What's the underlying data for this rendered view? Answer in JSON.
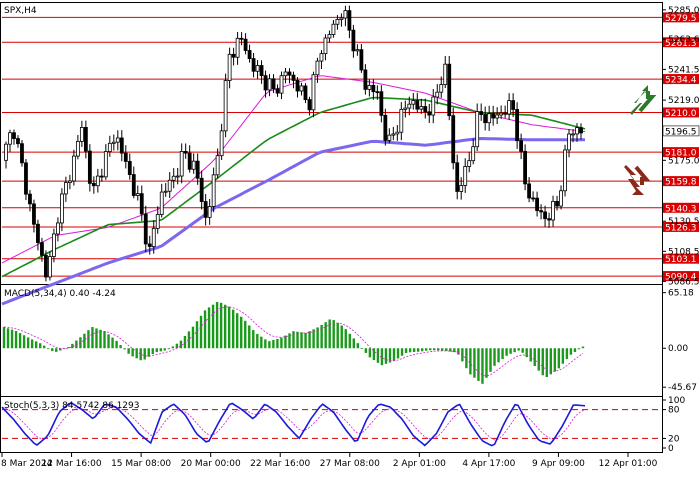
{
  "chart_data": [
    {
      "type": "candlestick",
      "title": "SPX,H4",
      "ylim": [
        5084.6,
        5290
      ],
      "yticks": [
        "5285.0",
        "5263.6",
        "5241.5",
        "5219.0",
        "5175.0",
        "5130.5",
        "5108.5",
        "5086.5"
      ],
      "levels": [
        {
          "value": 5279.5,
          "label": "5279.5"
        },
        {
          "value": 5261.3,
          "label": "5261.3"
        },
        {
          "value": 5234.4,
          "label": "5234.4"
        },
        {
          "value": 5210.0,
          "label": "5210.0"
        },
        {
          "value": 5181.0,
          "label": "5181.0"
        },
        {
          "value": 5159.8,
          "label": "5159.8"
        },
        {
          "value": 5140.3,
          "label": "5140.3"
        },
        {
          "value": 5126.3,
          "label": "5126.3"
        },
        {
          "value": 5103.1,
          "label": "5103.1"
        },
        {
          "value": 5090.4,
          "label": "5090.4"
        }
      ],
      "current_price": {
        "value": 5196.5,
        "label": "5196.5"
      },
      "moving_averages": [
        {
          "color": "#d81bd8",
          "anchors": [
            5100,
            5120,
            5126,
            5140,
            5175,
            5225,
            5237,
            5232,
            5224,
            5210,
            5201,
            5196
          ]
        },
        {
          "color": "#1a8a1a",
          "anchors": [
            5090,
            5110,
            5128,
            5131,
            5160,
            5190,
            5210,
            5221,
            5219,
            5210,
            5208,
            5198
          ]
        },
        {
          "color": "#7b68ee",
          "anchors": [
            5070,
            5085,
            5100,
            5112,
            5140,
            5160,
            5181,
            5189,
            5186,
            5191,
            5190,
            5190
          ]
        }
      ],
      "price_path": [
        5175,
        5200,
        5160,
        5120,
        5090,
        5140,
        5165,
        5200,
        5150,
        5175,
        5195,
        5170,
        5145,
        5108,
        5150,
        5160,
        5180,
        5170,
        5130,
        5178,
        5250,
        5265,
        5245,
        5235,
        5225,
        5240,
        5230,
        5215,
        5255,
        5270,
        5285,
        5260,
        5230,
        5225,
        5185,
        5205,
        5220,
        5210,
        5215,
        5245,
        5150,
        5170,
        5210,
        5205,
        5210,
        5215,
        5160,
        5140,
        5132,
        5145,
        5198,
        5196
      ]
    },
    {
      "type": "bar",
      "title": "MACD(5,34,4) 0.40 -4.24",
      "ylim": [
        -56,
        73
      ],
      "yticks": [
        "65.18",
        "0.00",
        "-45.67"
      ],
      "color": "#1a9a1a",
      "signal_color": "#d81bd8",
      "values_path": [
        25,
        20,
        12,
        5,
        -5,
        0,
        12,
        25,
        20,
        8,
        -8,
        -15,
        -5,
        -2,
        8,
        25,
        45,
        55,
        48,
        35,
        18,
        8,
        12,
        20,
        18,
        25,
        35,
        25,
        8,
        -10,
        -20,
        -15,
        -5,
        -4,
        -2,
        -3,
        -5,
        -30,
        -42,
        -20,
        -8,
        -2,
        -18,
        -35,
        -25,
        -8,
        2
      ]
    },
    {
      "type": "line",
      "title": "Stoch(5,3,3) 84.5742 86.1293",
      "ylim": [
        0,
        100
      ],
      "yticks": [
        "100",
        "80",
        "20",
        "0"
      ],
      "levels": [
        80,
        20
      ],
      "color": "#1a1ad8",
      "signal_color": "#d81bd8",
      "values_path": [
        85,
        60,
        30,
        5,
        25,
        75,
        95,
        80,
        60,
        92,
        85,
        60,
        30,
        10,
        75,
        92,
        70,
        30,
        10,
        55,
        95,
        80,
        60,
        92,
        75,
        45,
        20,
        60,
        92,
        75,
        40,
        10,
        65,
        92,
        85,
        60,
        25,
        5,
        30,
        75,
        92,
        50,
        15,
        3,
        55,
        95,
        50,
        15,
        8,
        45,
        90,
        88
      ],
      "time_labels": [
        "8 Mar 2024",
        "12 Mar 16:00",
        "15 Mar 08:00",
        "20 Mar 00:00",
        "22 Mar 16:00",
        "27 Mar 08:00",
        "2 Apr 01:00",
        "4 Apr 17:00",
        "9 Apr 09:00",
        "12 Apr 01:00"
      ]
    }
  ],
  "colors": {
    "level_line": "#d80000",
    "level_box": "#d80000",
    "arrow_up": "#2a7a2a",
    "arrow_down": "#8b2a1a"
  },
  "icons": {
    "arrow_up": "green-up-zigzag-arrow-icon",
    "arrow_down": "brown-down-zigzag-arrow-icon"
  }
}
